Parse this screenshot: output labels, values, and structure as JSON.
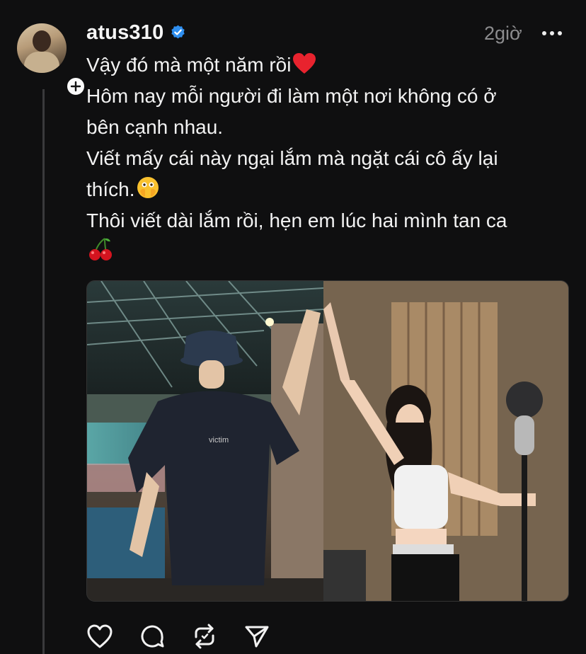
{
  "post": {
    "username": "atus310",
    "verified": true,
    "time": "2giờ",
    "lines": [
      "Vậy đó mà một năm rồi",
      "Hôm nay mỗi người đi làm một nơi không có ở",
      "bên cạnh nhau.",
      "Viết mấy cái này ngại lắm mà ngặt cái cô ấy lại",
      "thích.",
      "Thôi viết dài lắm rồi, hẹn em lúc hai mình tan ca"
    ],
    "emojis": [
      "red-heart",
      "face-with-open-eyes-and-hand-over-mouth",
      "cherries"
    ],
    "shirt_text": "victim"
  },
  "icons": {
    "like": "heart-icon",
    "comment": "comment-icon",
    "repost": "repost-icon",
    "share": "send-icon",
    "more": "more-icon",
    "follow": "plus-icon"
  },
  "colors": {
    "background": "#0f0f10",
    "verified": "#2f8ff0",
    "muted": "#8c8c8e"
  }
}
